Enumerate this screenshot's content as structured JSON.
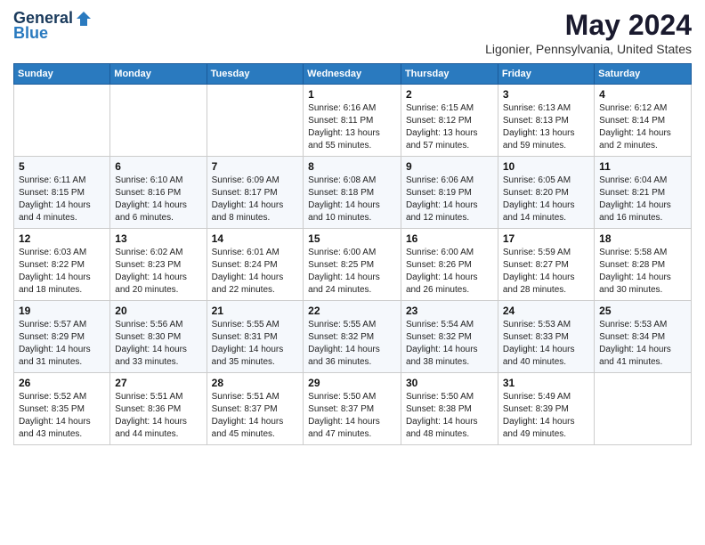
{
  "header": {
    "logo_general": "General",
    "logo_blue": "Blue",
    "month_title": "May 2024",
    "location": "Ligonier, Pennsylvania, United States"
  },
  "weekdays": [
    "Sunday",
    "Monday",
    "Tuesday",
    "Wednesday",
    "Thursday",
    "Friday",
    "Saturday"
  ],
  "weeks": [
    [
      {
        "day": "",
        "sunrise": "",
        "sunset": "",
        "daylight": ""
      },
      {
        "day": "",
        "sunrise": "",
        "sunset": "",
        "daylight": ""
      },
      {
        "day": "",
        "sunrise": "",
        "sunset": "",
        "daylight": ""
      },
      {
        "day": "1",
        "sunrise": "Sunrise: 6:16 AM",
        "sunset": "Sunset: 8:11 PM",
        "daylight": "Daylight: 13 hours and 55 minutes."
      },
      {
        "day": "2",
        "sunrise": "Sunrise: 6:15 AM",
        "sunset": "Sunset: 8:12 PM",
        "daylight": "Daylight: 13 hours and 57 minutes."
      },
      {
        "day": "3",
        "sunrise": "Sunrise: 6:13 AM",
        "sunset": "Sunset: 8:13 PM",
        "daylight": "Daylight: 13 hours and 59 minutes."
      },
      {
        "day": "4",
        "sunrise": "Sunrise: 6:12 AM",
        "sunset": "Sunset: 8:14 PM",
        "daylight": "Daylight: 14 hours and 2 minutes."
      }
    ],
    [
      {
        "day": "5",
        "sunrise": "Sunrise: 6:11 AM",
        "sunset": "Sunset: 8:15 PM",
        "daylight": "Daylight: 14 hours and 4 minutes."
      },
      {
        "day": "6",
        "sunrise": "Sunrise: 6:10 AM",
        "sunset": "Sunset: 8:16 PM",
        "daylight": "Daylight: 14 hours and 6 minutes."
      },
      {
        "day": "7",
        "sunrise": "Sunrise: 6:09 AM",
        "sunset": "Sunset: 8:17 PM",
        "daylight": "Daylight: 14 hours and 8 minutes."
      },
      {
        "day": "8",
        "sunrise": "Sunrise: 6:08 AM",
        "sunset": "Sunset: 8:18 PM",
        "daylight": "Daylight: 14 hours and 10 minutes."
      },
      {
        "day": "9",
        "sunrise": "Sunrise: 6:06 AM",
        "sunset": "Sunset: 8:19 PM",
        "daylight": "Daylight: 14 hours and 12 minutes."
      },
      {
        "day": "10",
        "sunrise": "Sunrise: 6:05 AM",
        "sunset": "Sunset: 8:20 PM",
        "daylight": "Daylight: 14 hours and 14 minutes."
      },
      {
        "day": "11",
        "sunrise": "Sunrise: 6:04 AM",
        "sunset": "Sunset: 8:21 PM",
        "daylight": "Daylight: 14 hours and 16 minutes."
      }
    ],
    [
      {
        "day": "12",
        "sunrise": "Sunrise: 6:03 AM",
        "sunset": "Sunset: 8:22 PM",
        "daylight": "Daylight: 14 hours and 18 minutes."
      },
      {
        "day": "13",
        "sunrise": "Sunrise: 6:02 AM",
        "sunset": "Sunset: 8:23 PM",
        "daylight": "Daylight: 14 hours and 20 minutes."
      },
      {
        "day": "14",
        "sunrise": "Sunrise: 6:01 AM",
        "sunset": "Sunset: 8:24 PM",
        "daylight": "Daylight: 14 hours and 22 minutes."
      },
      {
        "day": "15",
        "sunrise": "Sunrise: 6:00 AM",
        "sunset": "Sunset: 8:25 PM",
        "daylight": "Daylight: 14 hours and 24 minutes."
      },
      {
        "day": "16",
        "sunrise": "Sunrise: 6:00 AM",
        "sunset": "Sunset: 8:26 PM",
        "daylight": "Daylight: 14 hours and 26 minutes."
      },
      {
        "day": "17",
        "sunrise": "Sunrise: 5:59 AM",
        "sunset": "Sunset: 8:27 PM",
        "daylight": "Daylight: 14 hours and 28 minutes."
      },
      {
        "day": "18",
        "sunrise": "Sunrise: 5:58 AM",
        "sunset": "Sunset: 8:28 PM",
        "daylight": "Daylight: 14 hours and 30 minutes."
      }
    ],
    [
      {
        "day": "19",
        "sunrise": "Sunrise: 5:57 AM",
        "sunset": "Sunset: 8:29 PM",
        "daylight": "Daylight: 14 hours and 31 minutes."
      },
      {
        "day": "20",
        "sunrise": "Sunrise: 5:56 AM",
        "sunset": "Sunset: 8:30 PM",
        "daylight": "Daylight: 14 hours and 33 minutes."
      },
      {
        "day": "21",
        "sunrise": "Sunrise: 5:55 AM",
        "sunset": "Sunset: 8:31 PM",
        "daylight": "Daylight: 14 hours and 35 minutes."
      },
      {
        "day": "22",
        "sunrise": "Sunrise: 5:55 AM",
        "sunset": "Sunset: 8:32 PM",
        "daylight": "Daylight: 14 hours and 36 minutes."
      },
      {
        "day": "23",
        "sunrise": "Sunrise: 5:54 AM",
        "sunset": "Sunset: 8:32 PM",
        "daylight": "Daylight: 14 hours and 38 minutes."
      },
      {
        "day": "24",
        "sunrise": "Sunrise: 5:53 AM",
        "sunset": "Sunset: 8:33 PM",
        "daylight": "Daylight: 14 hours and 40 minutes."
      },
      {
        "day": "25",
        "sunrise": "Sunrise: 5:53 AM",
        "sunset": "Sunset: 8:34 PM",
        "daylight": "Daylight: 14 hours and 41 minutes."
      }
    ],
    [
      {
        "day": "26",
        "sunrise": "Sunrise: 5:52 AM",
        "sunset": "Sunset: 8:35 PM",
        "daylight": "Daylight: 14 hours and 43 minutes."
      },
      {
        "day": "27",
        "sunrise": "Sunrise: 5:51 AM",
        "sunset": "Sunset: 8:36 PM",
        "daylight": "Daylight: 14 hours and 44 minutes."
      },
      {
        "day": "28",
        "sunrise": "Sunrise: 5:51 AM",
        "sunset": "Sunset: 8:37 PM",
        "daylight": "Daylight: 14 hours and 45 minutes."
      },
      {
        "day": "29",
        "sunrise": "Sunrise: 5:50 AM",
        "sunset": "Sunset: 8:37 PM",
        "daylight": "Daylight: 14 hours and 47 minutes."
      },
      {
        "day": "30",
        "sunrise": "Sunrise: 5:50 AM",
        "sunset": "Sunset: 8:38 PM",
        "daylight": "Daylight: 14 hours and 48 minutes."
      },
      {
        "day": "31",
        "sunrise": "Sunrise: 5:49 AM",
        "sunset": "Sunset: 8:39 PM",
        "daylight": "Daylight: 14 hours and 49 minutes."
      },
      {
        "day": "",
        "sunrise": "",
        "sunset": "",
        "daylight": ""
      }
    ]
  ]
}
